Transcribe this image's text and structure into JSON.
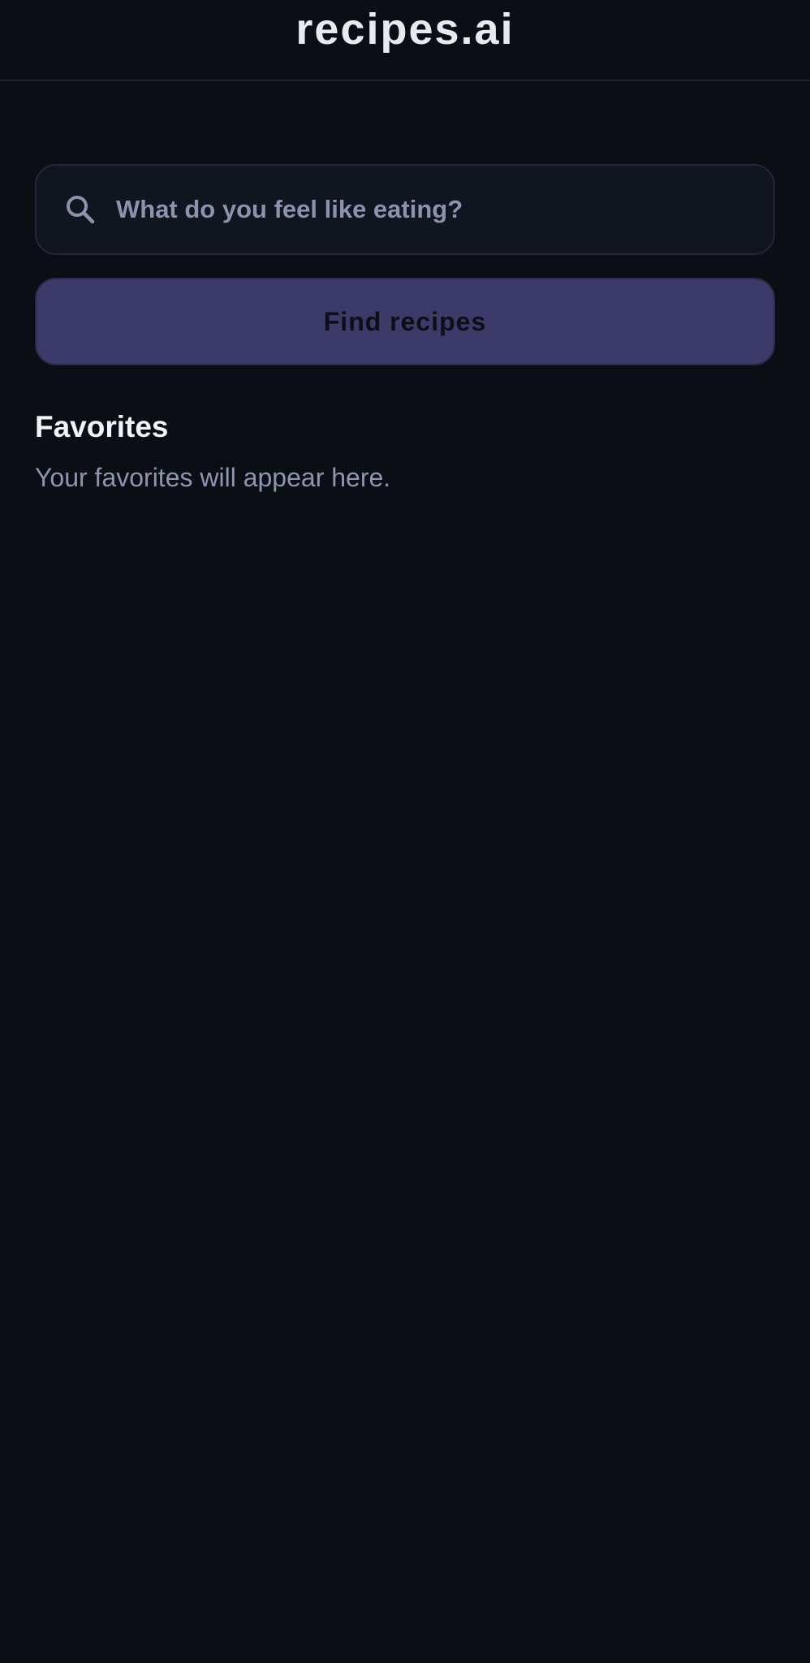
{
  "app": {
    "title": "recipes.ai"
  },
  "search": {
    "placeholder": "What do you feel like eating?",
    "value": "",
    "icon": "search-icon"
  },
  "actions": {
    "find_label": "Find recipes"
  },
  "favorites": {
    "heading": "Favorites",
    "empty_message": "Your favorites will appear here."
  },
  "colors": {
    "background": "#0b0e15",
    "accent_button": "#3c3a68",
    "title_text": "#e7eaf1",
    "muted_text": "#8e95ae"
  }
}
